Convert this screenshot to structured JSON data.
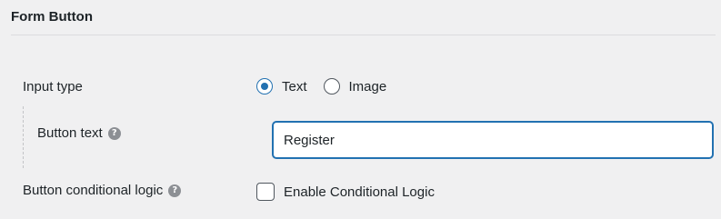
{
  "panel": {
    "title": "Form Button"
  },
  "input_type": {
    "label": "Input type",
    "options": [
      {
        "label": "Text",
        "checked": true
      },
      {
        "label": "Image",
        "checked": false
      }
    ]
  },
  "button_text": {
    "label": "Button text",
    "value": "Register",
    "help_icon": "question-circle-icon"
  },
  "conditional_logic": {
    "label": "Button conditional logic",
    "checkbox_label": "Enable Conditional Logic",
    "checked": false,
    "help_icon": "question-circle-icon"
  },
  "colors": {
    "accent": "#2271b1",
    "background": "#f0f0f1",
    "text": "#1d2327"
  }
}
